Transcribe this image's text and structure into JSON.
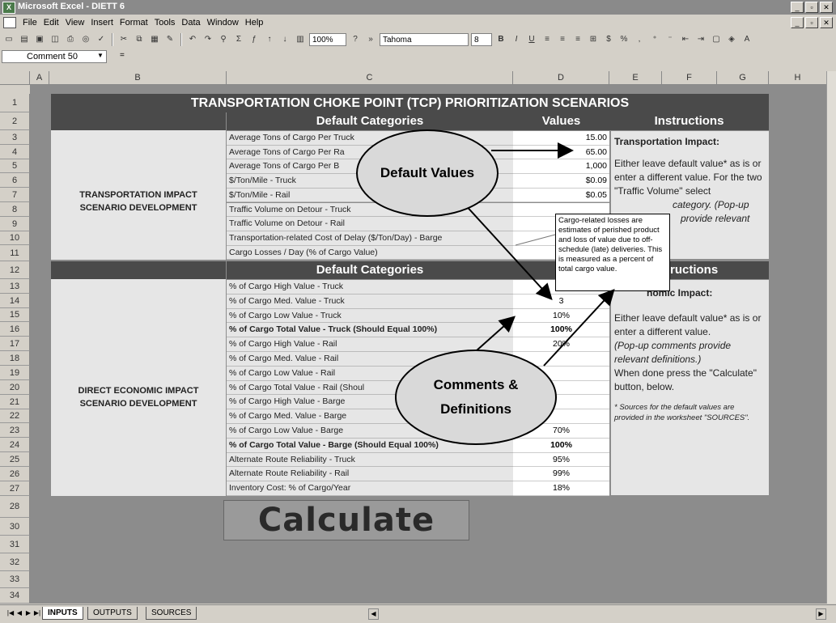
{
  "window": {
    "title": "Microsoft Excel - DIETT 6",
    "icon": "excel-icon"
  },
  "menu": [
    "File",
    "Edit",
    "View",
    "Insert",
    "Format",
    "Tools",
    "Data",
    "Window",
    "Help"
  ],
  "toolbar": {
    "zoom": "100%",
    "font": "Tahoma",
    "font_size": "8"
  },
  "formula_bar": {
    "name_box": "Comment 50",
    "fx": "="
  },
  "columns": [
    "A",
    "B",
    "C",
    "D",
    "E",
    "F",
    "G",
    "H"
  ],
  "rows": [
    "1",
    "2",
    "3",
    "4",
    "5",
    "6",
    "7",
    "8",
    "9",
    "10",
    "11",
    "12",
    "13",
    "14",
    "15",
    "16",
    "17",
    "18",
    "19",
    "20",
    "21",
    "22",
    "23",
    "24",
    "25",
    "26",
    "27",
    "28",
    "30",
    "31",
    "32",
    "33",
    "34"
  ],
  "sheet": {
    "title": "TRANSPORTATION CHOKE POINT (TCP) PRIORITIZATION SCENARIOS",
    "header_categories": "Default Categories",
    "header_values": "Values",
    "header_instructions": "Instructions",
    "header_values_2": "Va",
    "header_instructions_2": "ructions",
    "scenario1_line1": "TRANSPORTATION IMPACT",
    "scenario1_line2": "SCENARIO DEVELOPMENT",
    "scenario2_line1": "DIRECT ECONOMIC IMPACT",
    "scenario2_line2": "SCENARIO DEVELOPMENT",
    "transport_rows": [
      {
        "label": "Average Tons of Cargo Per Truck",
        "value": "15.00"
      },
      {
        "label": "Average Tons of Cargo Per Ra",
        "value": "65.00"
      },
      {
        "label": "Average Tons of Cargo Per B",
        "value": "1,000"
      },
      {
        "label": "$/Ton/Mile - Truck",
        "value": "$0.09"
      },
      {
        "label": "$/Ton/Mile - Rail",
        "value": "$0.05"
      },
      {
        "label": "Traffic Volume on Detour - Truck",
        "value": ""
      },
      {
        "label": "Traffic Volume on Detour - Rail",
        "value": ""
      },
      {
        "label": "Transportation-related Cost of Delay ($/Ton/Day) - Barge",
        "value": ""
      },
      {
        "label": "Cargo Losses / Day (% of Cargo Value)",
        "value": ""
      }
    ],
    "economic_rows": [
      {
        "label": "% of Cargo High Value - Truck",
        "value": "6"
      },
      {
        "label": "% of Cargo Med. Value - Truck",
        "value": "3"
      },
      {
        "label": "% of Cargo Low Value - Truck",
        "value": "10%"
      },
      {
        "label": "% of Cargo Total Value - Truck (Should Equal 100%)",
        "value": "100%"
      },
      {
        "label": "% of Cargo High Value - Rail",
        "value": "20%"
      },
      {
        "label": "% of Cargo Med. Value - Rail",
        "value": ""
      },
      {
        "label": "% of Cargo Low Value - Rail",
        "value": ""
      },
      {
        "label": "% of Cargo Total Value - Rail (Shoul",
        "value": ""
      },
      {
        "label": "% of Cargo High Value - Barge",
        "value": ""
      },
      {
        "label": "% of Cargo Med. Value - Barge",
        "value": ""
      },
      {
        "label": "% of Cargo Low Value - Barge",
        "value": "70%"
      },
      {
        "label": "% of Cargo Total Value - Barge (Should Equal 100%)",
        "value": "100%"
      },
      {
        "label": "Alternate Route Reliability - Truck",
        "value": "95%"
      },
      {
        "label": "Alternate Route Reliability - Rail",
        "value": "99%"
      },
      {
        "label": "Inventory Cost: % of Cargo/Year",
        "value": "18%"
      }
    ],
    "instr1_title": "Transportation Impact:",
    "instr1_body_a": "Either leave default value* as is or enter a different value. For the two \"Traffic Volume\" select",
    "instr1_body_b": "category. (Pop-up",
    "instr1_body_c": "provide relevant",
    "instr2_title": "nomic Impact:",
    "instr2_body": "Either leave default value* as is or enter a different value.",
    "instr2_italic": "(Pop-up comments provide relevant definitions.)",
    "instr2_tail": "When done press the \"Calculate\" button, below.",
    "instr2_note": "* Sources for the default values are provided in the worksheet \"SOURCES\".",
    "popup": "Cargo-related losses are estimates of perished product and loss of value due to off-schedule (late) deliveries. This is measured as a percent of total cargo value.",
    "bubble1": "Default Values",
    "bubble2": "Comments & Definitions",
    "calculate": "Calculate"
  },
  "tabs": [
    "INPUTS",
    "OUTPUTS",
    "SOURCES"
  ],
  "colors": {
    "dark_header": "#4a4a4a",
    "panel": "#e6e6e6",
    "sheet_bg": "#8c8c8c"
  }
}
